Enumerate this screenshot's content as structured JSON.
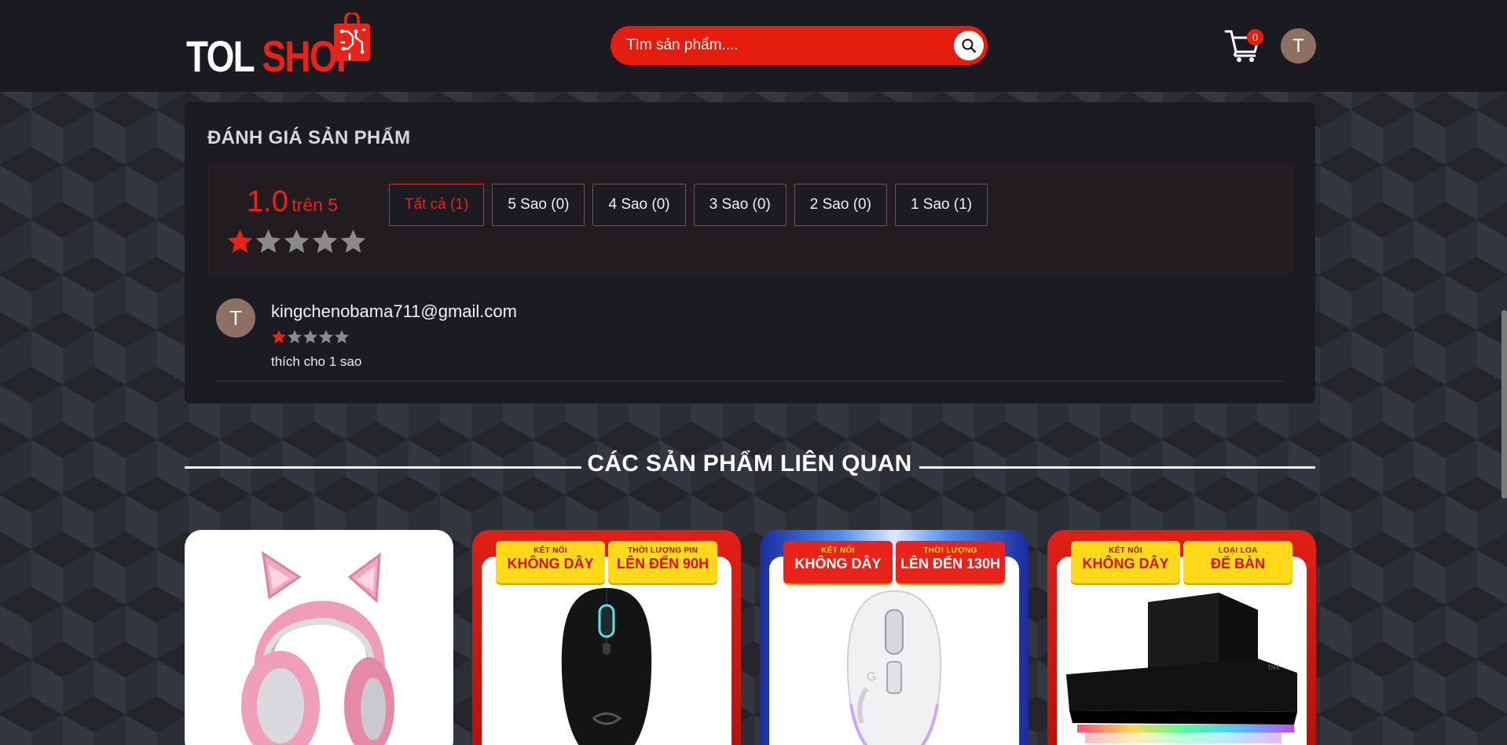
{
  "header": {
    "logo_part1": "TOL",
    "logo_part2": "SHOP",
    "search_placeholder": "Tìm sản phẩm....",
    "cart_count": "0",
    "user_initial": "T",
    "colors": {
      "accent": "#e41d0e",
      "header_bg": "#1b1a20"
    }
  },
  "reviews": {
    "title": "ĐÁNH GIÁ SẢN PHẨM",
    "average_value": "1.0",
    "average_suffix": "trên 5",
    "average_rating": 1,
    "max_rating": 5,
    "filters": [
      {
        "label": "Tất cả (1)",
        "active": true
      },
      {
        "label": "5 Sao (0)",
        "active": false
      },
      {
        "label": "4 Sao (0)",
        "active": false
      },
      {
        "label": "3 Sao (0)",
        "active": false
      },
      {
        "label": "2 Sao (0)",
        "active": false
      },
      {
        "label": "1 Sao (1)",
        "active": false
      }
    ],
    "items": [
      {
        "avatar_initial": "T",
        "email": "kingchenobama711@gmail.com",
        "rating": 1,
        "text": "thích cho 1 sao"
      }
    ]
  },
  "related": {
    "title": "CÁC SẢN PHẨM LIÊN QUAN",
    "products": [
      {
        "image": "pink-cat-ear-headset",
        "tags": []
      },
      {
        "image": "black-gaming-mouse",
        "tags": [
          {
            "top": "KẾT NỐI",
            "main": "KHÔNG DÂY"
          },
          {
            "top": "THỜI LƯỢNG PIN",
            "main": "LÊN ĐẾN 90H"
          }
        ]
      },
      {
        "image": "white-gaming-mouse",
        "tags": [
          {
            "top": "KẾT NỐI",
            "main": "KHÔNG DÂY"
          },
          {
            "top": "THỜI LƯỢNG",
            "main": "LÊN ĐẾN 130H"
          }
        ]
      },
      {
        "image": "rgb-soundbar-speaker",
        "tags": [
          {
            "top": "KẾT NỐI",
            "main": "KHÔNG DÂY"
          },
          {
            "top": "LOẠI LOA",
            "main": "ĐỂ BÀN"
          }
        ]
      }
    ]
  }
}
